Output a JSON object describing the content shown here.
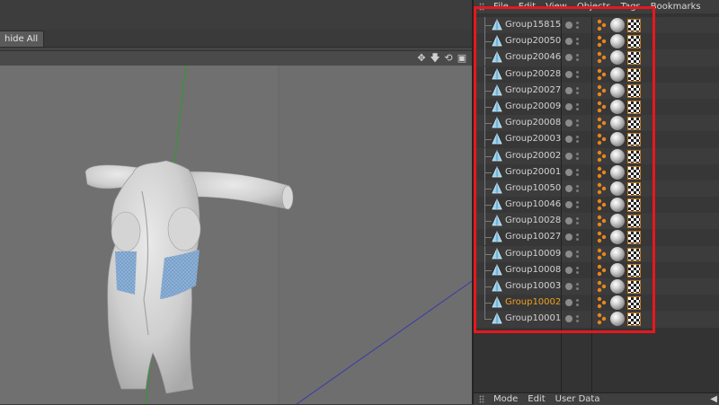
{
  "toolbar": {
    "unhide_all_label": "hide All"
  },
  "viewport_icons": [
    {
      "name": "move-icon",
      "glyph": "✥"
    },
    {
      "name": "arrow-down-icon",
      "glyph": "🡇"
    },
    {
      "name": "rotate-icon",
      "glyph": "⟲"
    },
    {
      "name": "maximize-icon",
      "glyph": "▣"
    }
  ],
  "object_manager": {
    "menu": [
      "File",
      "Edit",
      "View",
      "Objects",
      "Tags",
      "Bookmarks"
    ],
    "objects": [
      {
        "name": "Group15815"
      },
      {
        "name": "Group20050"
      },
      {
        "name": "Group20046"
      },
      {
        "name": "Group20028"
      },
      {
        "name": "Group20027"
      },
      {
        "name": "Group20009"
      },
      {
        "name": "Group20008"
      },
      {
        "name": "Group20003"
      },
      {
        "name": "Group20002"
      },
      {
        "name": "Group20001"
      },
      {
        "name": "Group10050"
      },
      {
        "name": "Group10046"
      },
      {
        "name": "Group10028"
      },
      {
        "name": "Group10027"
      },
      {
        "name": "Group10009"
      },
      {
        "name": "Group10008"
      },
      {
        "name": "Group10003"
      },
      {
        "name": "Group10002",
        "selected": true
      },
      {
        "name": "Group10001"
      }
    ]
  },
  "attributes": {
    "menu": [
      "Mode",
      "Edit",
      "User Data"
    ]
  },
  "colors": {
    "highlight_box": "#e8171d",
    "selected_text": "#f0a020",
    "mesh_blue": "#8fb3d9",
    "viewport_bg": "#6e6e6e"
  }
}
